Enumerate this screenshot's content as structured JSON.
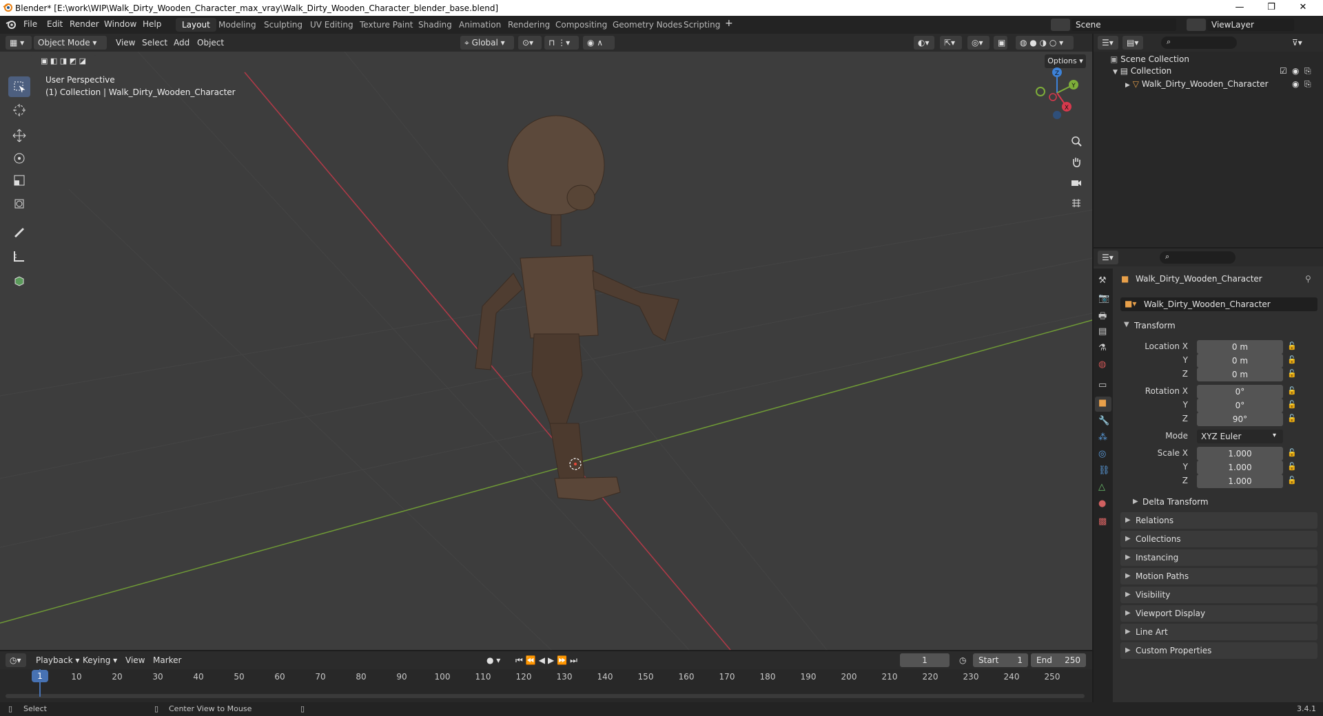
{
  "titlebar": {
    "title": "Blender* [E:\\work\\WIP\\Walk_Dirty_Wooden_Character_max_vray\\Walk_Dirty_Wooden_Character_blender_base.blend]",
    "minimize": "—",
    "restore": "❐",
    "close": "✕"
  },
  "menu": [
    "File",
    "Edit",
    "Render",
    "Window",
    "Help"
  ],
  "workspaces": [
    "Layout",
    "Modeling",
    "Sculpting",
    "UV Editing",
    "Texture Paint",
    "Shading",
    "Animation",
    "Rendering",
    "Compositing",
    "Geometry Nodes",
    "Scripting"
  ],
  "active_workspace": "Layout",
  "scene": {
    "label": "Scene",
    "view_layer": "ViewLayer"
  },
  "viewport_header": {
    "mode": "Object Mode",
    "menus": [
      "View",
      "Select",
      "Add",
      "Object"
    ],
    "orientation": "Global",
    "options": "Options"
  },
  "viewport": {
    "perspective": "User Perspective",
    "collection_info": "(1) Collection | Walk_Dirty_Wooden_Character",
    "gizmo": {
      "x": "X",
      "y": "Y",
      "z": "Z"
    }
  },
  "outliner": {
    "root": "Scene Collection",
    "collection": "Collection",
    "object": "Walk_Dirty_Wooden_Character"
  },
  "properties": {
    "object_name": "Walk_Dirty_Wooden_Character",
    "data_name": "Walk_Dirty_Wooden_Character",
    "transform_label": "Transform",
    "location": {
      "label_x": "Location X",
      "label_y": "Y",
      "label_z": "Z",
      "x": "0 m",
      "y": "0 m",
      "z": "0 m"
    },
    "rotation": {
      "label_x": "Rotation X",
      "label_y": "Y",
      "label_z": "Z",
      "x": "0°",
      "y": "0°",
      "z": "90°"
    },
    "mode": {
      "label": "Mode",
      "value": "XYZ Euler"
    },
    "scale": {
      "label_x": "Scale X",
      "label_y": "Y",
      "label_z": "Z",
      "x": "1.000",
      "y": "1.000",
      "z": "1.000"
    },
    "delta_transform": "Delta Transform",
    "panels": [
      "Relations",
      "Collections",
      "Instancing",
      "Motion Paths",
      "Visibility",
      "Viewport Display",
      "Line Art",
      "Custom Properties"
    ]
  },
  "timeline": {
    "menus": [
      "Playback",
      "Keying",
      "View",
      "Marker"
    ],
    "current_frame": "1",
    "start_label": "Start",
    "start": "1",
    "end_label": "End",
    "end": "250",
    "ticks": [
      "10",
      "20",
      "30",
      "40",
      "50",
      "60",
      "70",
      "80",
      "90",
      "100",
      "110",
      "120",
      "130",
      "140",
      "150",
      "160",
      "170",
      "180",
      "190",
      "200",
      "210",
      "220",
      "230",
      "240",
      "250"
    ],
    "playhead": "1"
  },
  "statusbar": {
    "select": "Select",
    "center_view": "Center View to Mouse",
    "version": "3.4.1"
  },
  "colors": {
    "accent_blue": "#4772b3",
    "x_axis": "#d8394d",
    "y_axis": "#7eae3a",
    "z_axis": "#3d82d8"
  }
}
